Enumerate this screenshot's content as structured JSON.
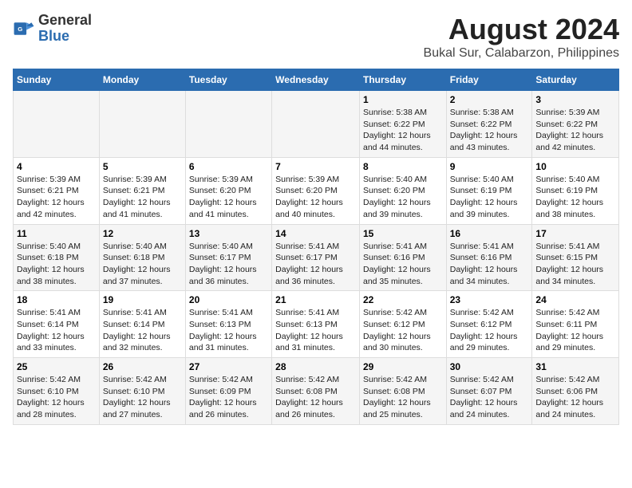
{
  "header": {
    "logo_general": "General",
    "logo_blue": "Blue",
    "title": "August 2024",
    "subtitle": "Bukal Sur, Calabarzon, Philippines"
  },
  "days_of_week": [
    "Sunday",
    "Monday",
    "Tuesday",
    "Wednesday",
    "Thursday",
    "Friday",
    "Saturday"
  ],
  "weeks": [
    [
      {
        "day": "",
        "info": ""
      },
      {
        "day": "",
        "info": ""
      },
      {
        "day": "",
        "info": ""
      },
      {
        "day": "",
        "info": ""
      },
      {
        "day": "1",
        "info": "Sunrise: 5:38 AM\nSunset: 6:22 PM\nDaylight: 12 hours\nand 44 minutes."
      },
      {
        "day": "2",
        "info": "Sunrise: 5:38 AM\nSunset: 6:22 PM\nDaylight: 12 hours\nand 43 minutes."
      },
      {
        "day": "3",
        "info": "Sunrise: 5:39 AM\nSunset: 6:22 PM\nDaylight: 12 hours\nand 42 minutes."
      }
    ],
    [
      {
        "day": "4",
        "info": "Sunrise: 5:39 AM\nSunset: 6:21 PM\nDaylight: 12 hours\nand 42 minutes."
      },
      {
        "day": "5",
        "info": "Sunrise: 5:39 AM\nSunset: 6:21 PM\nDaylight: 12 hours\nand 41 minutes."
      },
      {
        "day": "6",
        "info": "Sunrise: 5:39 AM\nSunset: 6:20 PM\nDaylight: 12 hours\nand 41 minutes."
      },
      {
        "day": "7",
        "info": "Sunrise: 5:39 AM\nSunset: 6:20 PM\nDaylight: 12 hours\nand 40 minutes."
      },
      {
        "day": "8",
        "info": "Sunrise: 5:40 AM\nSunset: 6:20 PM\nDaylight: 12 hours\nand 39 minutes."
      },
      {
        "day": "9",
        "info": "Sunrise: 5:40 AM\nSunset: 6:19 PM\nDaylight: 12 hours\nand 39 minutes."
      },
      {
        "day": "10",
        "info": "Sunrise: 5:40 AM\nSunset: 6:19 PM\nDaylight: 12 hours\nand 38 minutes."
      }
    ],
    [
      {
        "day": "11",
        "info": "Sunrise: 5:40 AM\nSunset: 6:18 PM\nDaylight: 12 hours\nand 38 minutes."
      },
      {
        "day": "12",
        "info": "Sunrise: 5:40 AM\nSunset: 6:18 PM\nDaylight: 12 hours\nand 37 minutes."
      },
      {
        "day": "13",
        "info": "Sunrise: 5:40 AM\nSunset: 6:17 PM\nDaylight: 12 hours\nand 36 minutes."
      },
      {
        "day": "14",
        "info": "Sunrise: 5:41 AM\nSunset: 6:17 PM\nDaylight: 12 hours\nand 36 minutes."
      },
      {
        "day": "15",
        "info": "Sunrise: 5:41 AM\nSunset: 6:16 PM\nDaylight: 12 hours\nand 35 minutes."
      },
      {
        "day": "16",
        "info": "Sunrise: 5:41 AM\nSunset: 6:16 PM\nDaylight: 12 hours\nand 34 minutes."
      },
      {
        "day": "17",
        "info": "Sunrise: 5:41 AM\nSunset: 6:15 PM\nDaylight: 12 hours\nand 34 minutes."
      }
    ],
    [
      {
        "day": "18",
        "info": "Sunrise: 5:41 AM\nSunset: 6:14 PM\nDaylight: 12 hours\nand 33 minutes."
      },
      {
        "day": "19",
        "info": "Sunrise: 5:41 AM\nSunset: 6:14 PM\nDaylight: 12 hours\nand 32 minutes."
      },
      {
        "day": "20",
        "info": "Sunrise: 5:41 AM\nSunset: 6:13 PM\nDaylight: 12 hours\nand 31 minutes."
      },
      {
        "day": "21",
        "info": "Sunrise: 5:41 AM\nSunset: 6:13 PM\nDaylight: 12 hours\nand 31 minutes."
      },
      {
        "day": "22",
        "info": "Sunrise: 5:42 AM\nSunset: 6:12 PM\nDaylight: 12 hours\nand 30 minutes."
      },
      {
        "day": "23",
        "info": "Sunrise: 5:42 AM\nSunset: 6:12 PM\nDaylight: 12 hours\nand 29 minutes."
      },
      {
        "day": "24",
        "info": "Sunrise: 5:42 AM\nSunset: 6:11 PM\nDaylight: 12 hours\nand 29 minutes."
      }
    ],
    [
      {
        "day": "25",
        "info": "Sunrise: 5:42 AM\nSunset: 6:10 PM\nDaylight: 12 hours\nand 28 minutes."
      },
      {
        "day": "26",
        "info": "Sunrise: 5:42 AM\nSunset: 6:10 PM\nDaylight: 12 hours\nand 27 minutes."
      },
      {
        "day": "27",
        "info": "Sunrise: 5:42 AM\nSunset: 6:09 PM\nDaylight: 12 hours\nand 26 minutes."
      },
      {
        "day": "28",
        "info": "Sunrise: 5:42 AM\nSunset: 6:08 PM\nDaylight: 12 hours\nand 26 minutes."
      },
      {
        "day": "29",
        "info": "Sunrise: 5:42 AM\nSunset: 6:08 PM\nDaylight: 12 hours\nand 25 minutes."
      },
      {
        "day": "30",
        "info": "Sunrise: 5:42 AM\nSunset: 6:07 PM\nDaylight: 12 hours\nand 24 minutes."
      },
      {
        "day": "31",
        "info": "Sunrise: 5:42 AM\nSunset: 6:06 PM\nDaylight: 12 hours\nand 24 minutes."
      }
    ]
  ]
}
